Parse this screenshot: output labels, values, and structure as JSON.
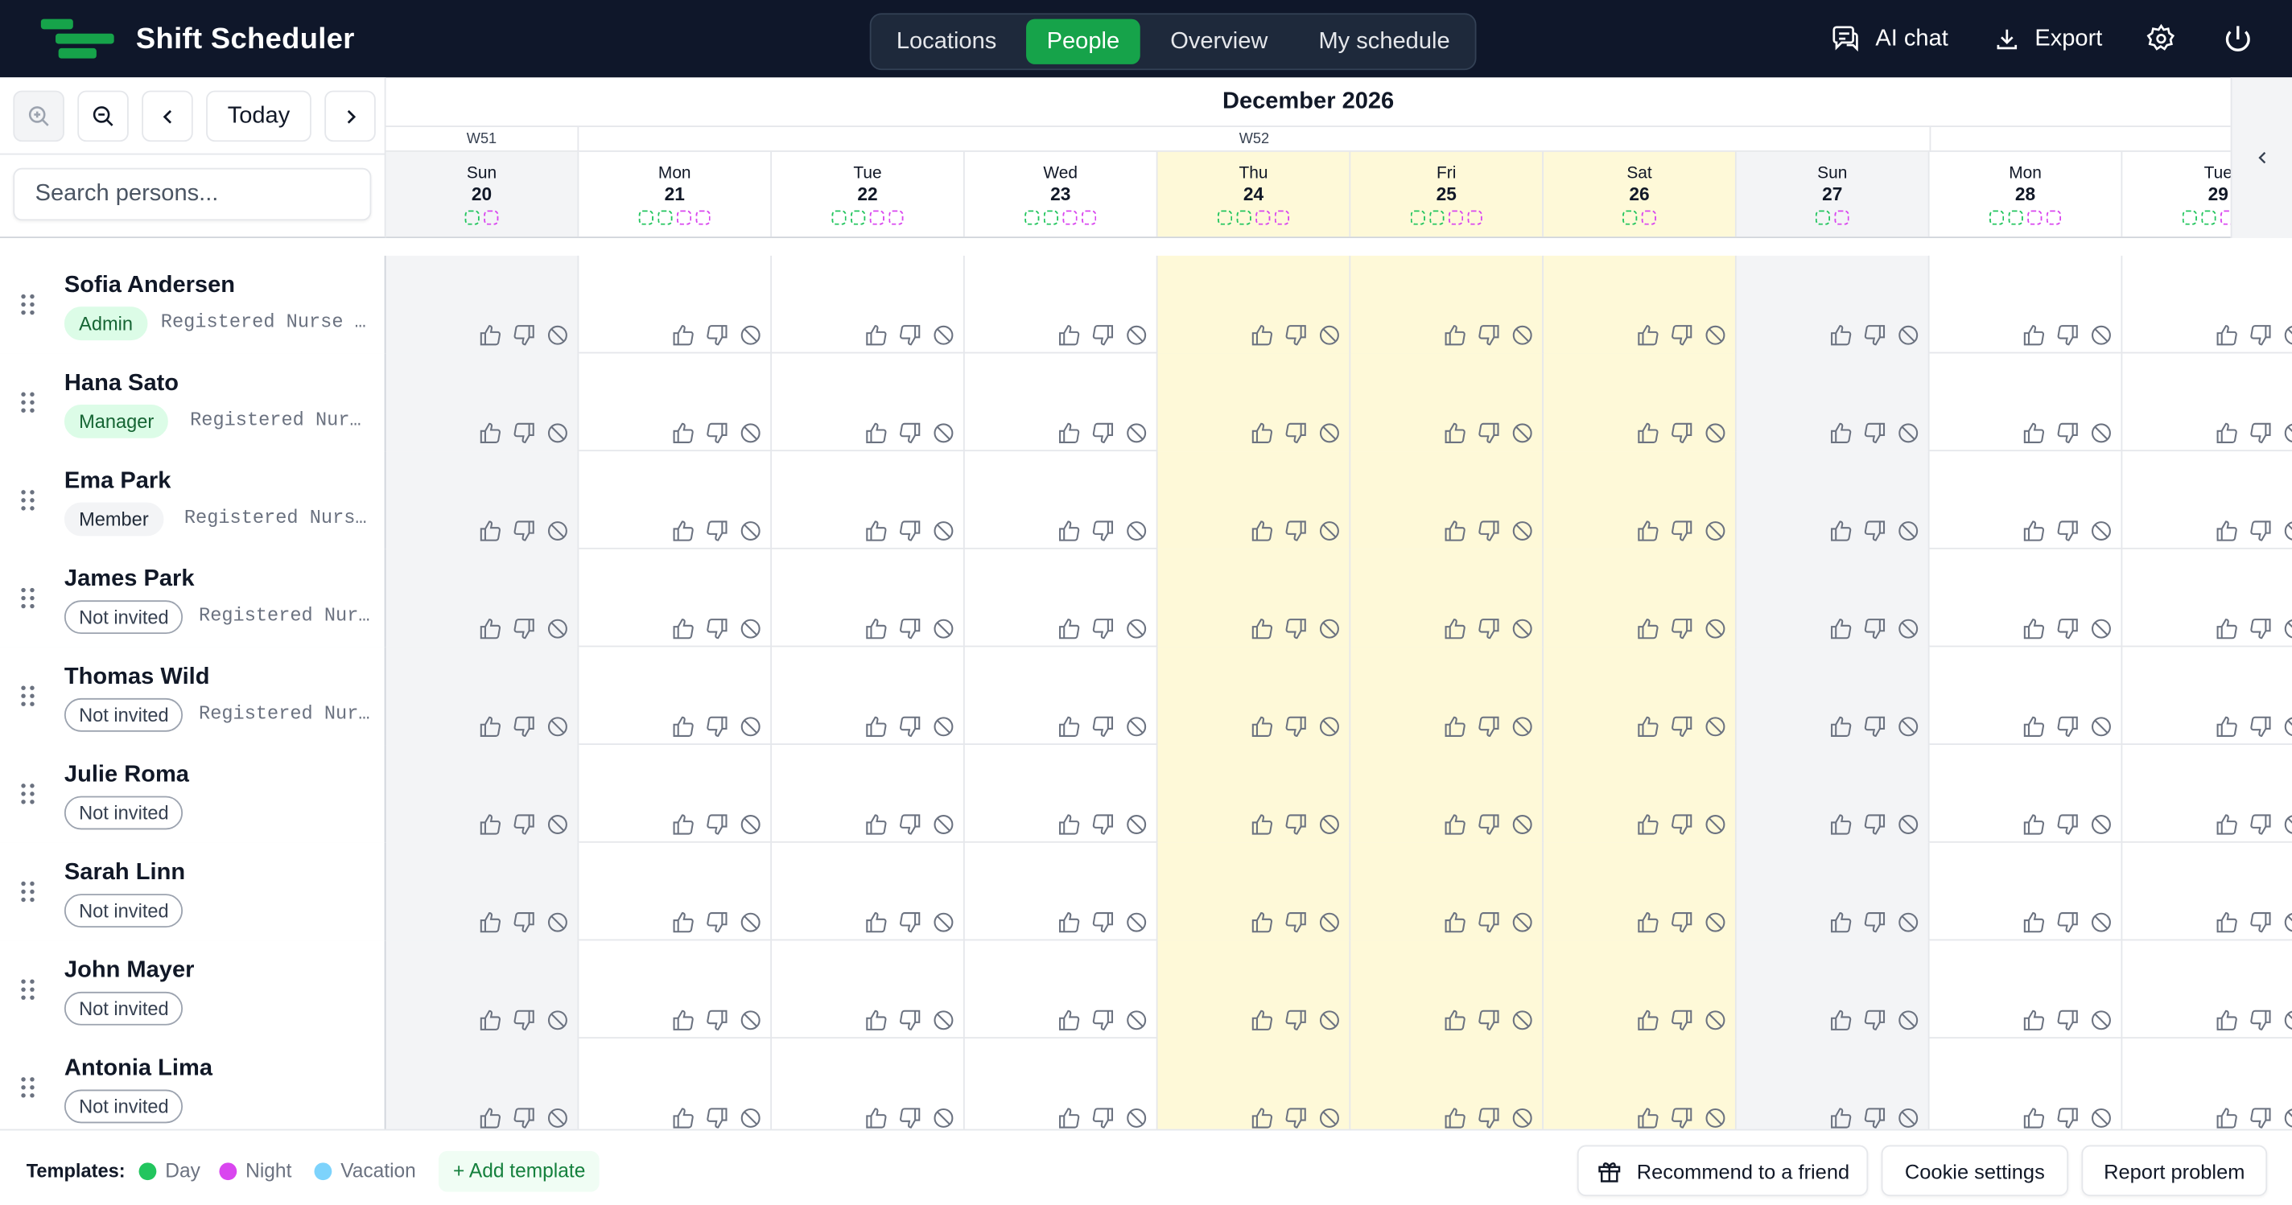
{
  "app": {
    "title": "Shift Scheduler"
  },
  "nav": {
    "tabs": [
      "Locations",
      "People",
      "Overview",
      "My schedule"
    ],
    "active": "People"
  },
  "top_actions": {
    "ai_chat": "AI chat",
    "export": "Export"
  },
  "toolbar": {
    "today": "Today"
  },
  "search": {
    "placeholder": "Search persons..."
  },
  "calendar": {
    "month": "December 2026",
    "weeks": [
      "W51",
      "W52"
    ],
    "days": [
      {
        "name": "Sun",
        "date": "20",
        "dots": [
          "green",
          "magenta"
        ],
        "shade": "weekend"
      },
      {
        "name": "Mon",
        "date": "21",
        "dots": [
          "green",
          "green",
          "magenta",
          "magenta"
        ],
        "shade": "none"
      },
      {
        "name": "Tue",
        "date": "22",
        "dots": [
          "green",
          "green",
          "magenta",
          "magenta"
        ],
        "shade": "none"
      },
      {
        "name": "Wed",
        "date": "23",
        "dots": [
          "green",
          "green",
          "magenta",
          "magenta"
        ],
        "shade": "none"
      },
      {
        "name": "Thu",
        "date": "24",
        "dots": [
          "green",
          "green",
          "magenta",
          "magenta"
        ],
        "shade": "holiday"
      },
      {
        "name": "Fri",
        "date": "25",
        "dots": [
          "green",
          "green",
          "magenta",
          "magenta"
        ],
        "shade": "holiday"
      },
      {
        "name": "Sat",
        "date": "26",
        "dots": [
          "green",
          "magenta"
        ],
        "shade": "holiday"
      },
      {
        "name": "Sun",
        "date": "27",
        "dots": [
          "green",
          "magenta"
        ],
        "shade": "weekend"
      },
      {
        "name": "Mon",
        "date": "28",
        "dots": [
          "green",
          "green",
          "magenta",
          "magenta"
        ],
        "shade": "none"
      },
      {
        "name": "Tue",
        "date": "29",
        "dots": [
          "green",
          "green",
          "magenta",
          "magenta"
        ],
        "shade": "none"
      }
    ]
  },
  "people": [
    {
      "name": "Sofia Andersen",
      "badge": "Admin",
      "badge_type": "admin",
      "role": "Registered Nurse …"
    },
    {
      "name": "Hana Sato",
      "badge": "Manager",
      "badge_type": "manager",
      "role": "Registered Nurse…"
    },
    {
      "name": "Ema Park",
      "badge": "Member",
      "badge_type": "member",
      "role": "Registered Nurse…"
    },
    {
      "name": "James Park",
      "badge": "Not invited",
      "badge_type": "notinv",
      "role": "Registered Nur…"
    },
    {
      "name": "Thomas Wild",
      "badge": "Not invited",
      "badge_type": "notinv",
      "role": "Registered Nur…"
    },
    {
      "name": "Julie Roma",
      "badge": "Not invited",
      "badge_type": "notinv",
      "role": ""
    },
    {
      "name": "Sarah Linn",
      "badge": "Not invited",
      "badge_type": "notinv",
      "role": ""
    },
    {
      "name": "John Mayer",
      "badge": "Not invited",
      "badge_type": "notinv",
      "role": ""
    },
    {
      "name": "Antonia Lima",
      "badge": "Not invited",
      "badge_type": "notinv",
      "role": ""
    }
  ],
  "footer": {
    "templates_label": "Templates:",
    "templates": [
      {
        "label": "Day",
        "color": "#22c55e"
      },
      {
        "label": "Night",
        "color": "#d946ef"
      },
      {
        "label": "Vacation",
        "color": "#7dd3fc"
      }
    ],
    "add_template": "Add template",
    "recommend": "Recommend to a friend",
    "cookie": "Cookie settings",
    "report": "Report problem"
  },
  "colors": {
    "brand": "#16a34a",
    "topbar": "#0f172a",
    "holiday": "#fef9d8",
    "weekend": "#f3f4f6"
  }
}
